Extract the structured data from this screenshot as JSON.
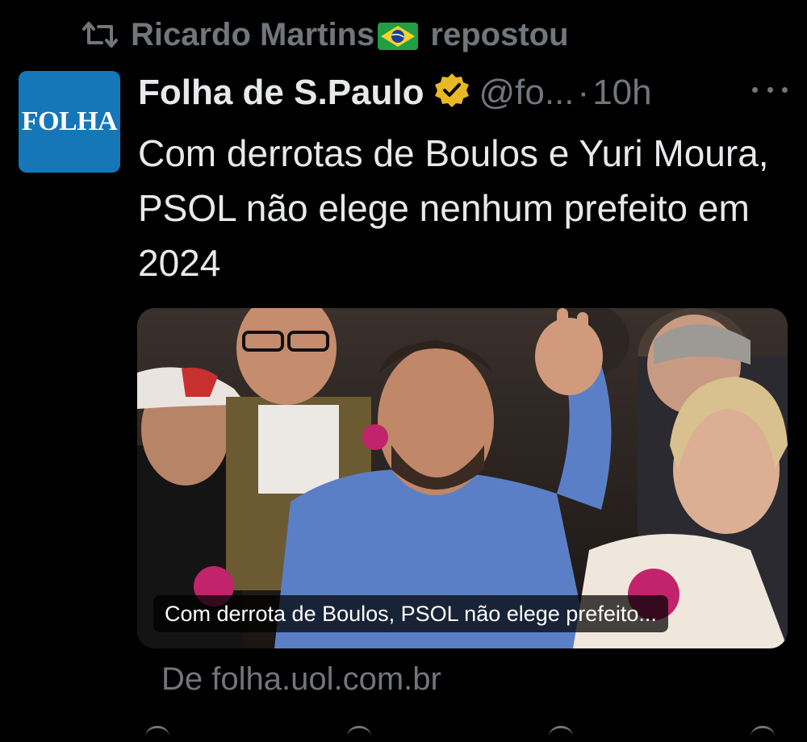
{
  "repost": {
    "user": "Ricardo Martins",
    "flag_icon": "brazil-flag-icon",
    "action": "repostou"
  },
  "tweet": {
    "avatar_text": "FOLHA",
    "author": "Folha de S.Paulo",
    "handle": "@fo...",
    "separator": "·",
    "time": "10h",
    "text": "Com derrotas de Boulos e Yuri Moura, PSOL não elege nenhum prefeito em 2024"
  },
  "card": {
    "caption": "Com derrota de Boulos, PSOL não elege prefeito...",
    "source": "De folha.uol.com.br"
  },
  "colors": {
    "background": "#000000",
    "text": "#e7e9ea",
    "muted": "#71767b",
    "verified_gold": "#e8b923",
    "avatar_blue": "#1577b8"
  }
}
